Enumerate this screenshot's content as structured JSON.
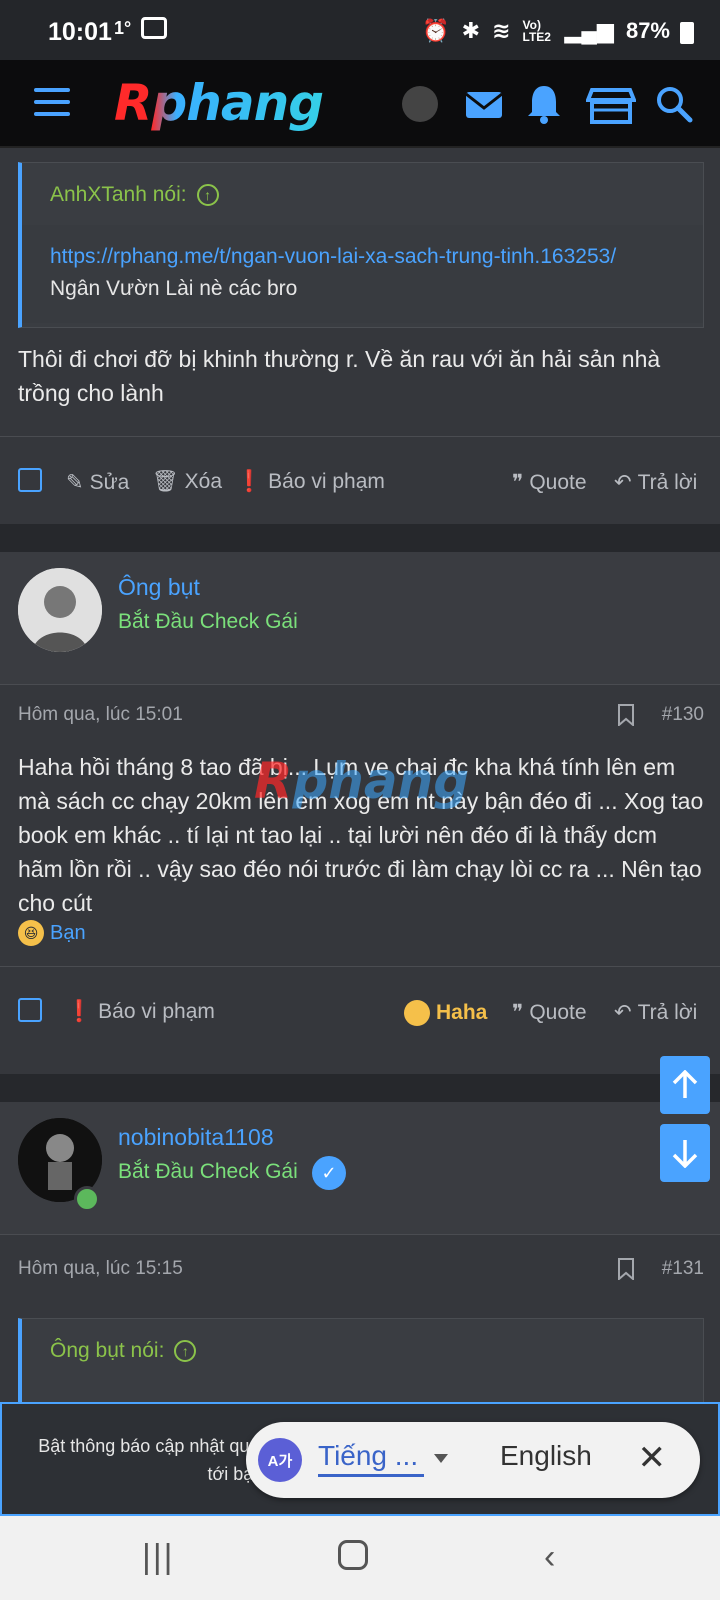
{
  "status_bar": {
    "time": "10:01",
    "battery": "87%",
    "network": "Vo) LTE2"
  },
  "navbar": {
    "logo": "Rphang"
  },
  "post1": {
    "quote_author": "AnhXTanh nói:",
    "quote_link": "https://rphang.me/t/ngan-vuon-lai-xa-sach-trung-tinh.163253/",
    "quote_text": "Ngân Vườn Lài nè các bro",
    "message": "Thôi đi chơi đỡ bị khinh thường r. Về ăn rau với ăn hải sản nhà trồng cho lành",
    "actions": {
      "edit": "Sửa",
      "delete": "Xóa",
      "report": "Báo vi phạm",
      "quote": "Quote",
      "reply": "Trả lời"
    }
  },
  "post2": {
    "username": "Ông bụt",
    "user_title": "Bắt Đầu Check Gái",
    "date": "Hôm qua, lúc 15:01",
    "number": "#130",
    "message": "Haha hồi tháng 8 tao đã bị... Lụm ve chai đc kha khá tính lên em mà sách cc chạy 20km lên em xog em nt này bận đéo đi ... Xog tao book em khác .. tí lại nt tao lại .. tại lười nên đéo đi là thấy dcm hãm lồn rồi .. vậy sao đéo nói trước đi làm chạy lòi cc ra ... Nên tạo cho cút",
    "reaction_user": "Bạn",
    "actions": {
      "report": "Báo vi phạm",
      "haha": "Haha",
      "quote": "Quote",
      "reply": "Trả lời"
    }
  },
  "post3": {
    "username": "nobinobita1108",
    "user_title": "Bắt Đầu Check Gái",
    "date": "Hôm qua, lúc 15:15",
    "number": "#131",
    "quote_author": "Ông bụt nói:"
  },
  "notice": {
    "text": "Bật thông báo cập nhật quan trọng về hoạt động diễn đàn và những gì liên quan tới bạn của bạn. Nhấn vào đây để bắt"
  },
  "translate_bar": {
    "source_lang": "Tiếng ...",
    "target_lang": "English"
  },
  "colors": {
    "accent": "#4aa3ff",
    "user_title": "#7be07b",
    "quote_head": "#8bc34a",
    "haha": "#f5c04a"
  }
}
